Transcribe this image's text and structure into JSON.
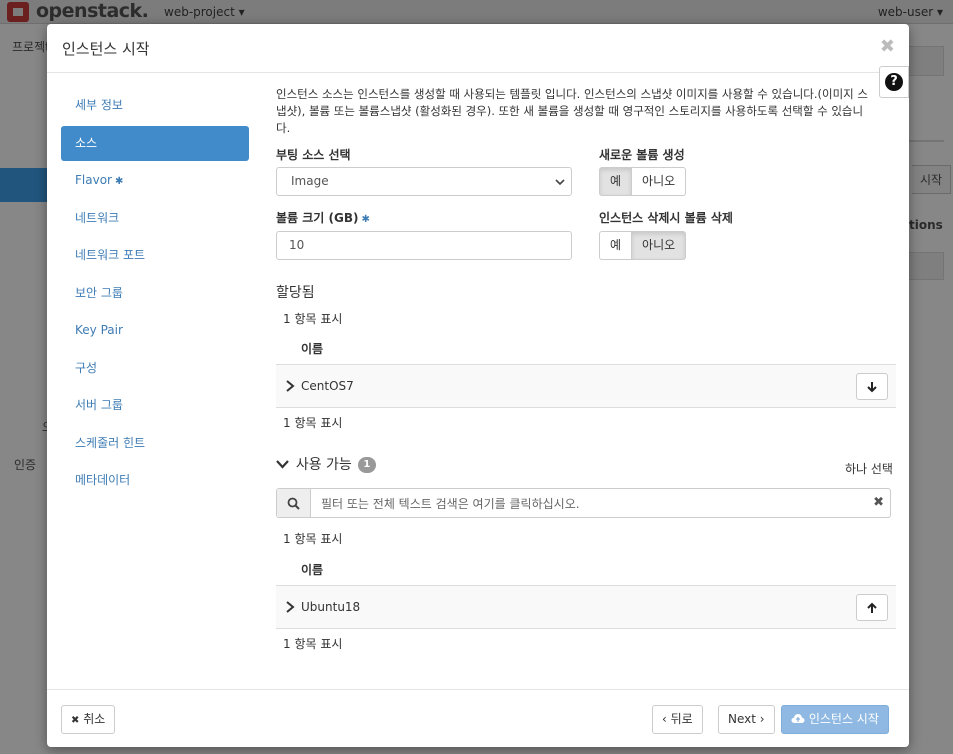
{
  "background": {
    "brand": "openstack.",
    "project": "web-project ▾",
    "user": "web-user ▾",
    "left_label_1": "프로젝t",
    "left_label_2": "인증",
    "left_label_3": "오",
    "right_btn": "시작",
    "right_label": "tions"
  },
  "modal": {
    "title": "인스턴스 시작",
    "close": "✖",
    "help": "?"
  },
  "sidebar": {
    "items": [
      {
        "label": "세부 정보"
      },
      {
        "label": "소스"
      },
      {
        "label": "Flavor"
      },
      {
        "label": "네트워크"
      },
      {
        "label": "네트워크 포트"
      },
      {
        "label": "보안 그룹"
      },
      {
        "label": "Key Pair"
      },
      {
        "label": "구성"
      },
      {
        "label": "서버 그룹"
      },
      {
        "label": "스케줄러 힌트"
      },
      {
        "label": "메타데이터"
      }
    ],
    "required_mark": "✱"
  },
  "source": {
    "description": "인스턴스 소스는 인스턴스를 생성할 때 사용되는 템플릿 입니다. 인스턴스의 스냅샷 이미지를 사용할 수 있습니다.(이미지 스냅샷), 볼륨 또는 볼륨스냅샷 (활성화된 경우). 또한 새 볼륨을 생성할 때 영구적인 스토리지를 사용하도록 선택할 수 있습니다.",
    "boot_source_label": "부팅 소스 선택",
    "boot_source_value": "Image",
    "new_volume_label": "새로운 볼륨 생성",
    "new_volume_yes": "예",
    "new_volume_no": "아니오",
    "volume_size_label": "볼륨 크기 (GB)",
    "volume_size_value": "10",
    "delete_volume_label": "인스턴스 삭제시 볼륨 삭제",
    "delete_volume_yes": "예",
    "delete_volume_no": "아니오"
  },
  "allocated": {
    "title": "할당됨",
    "count_top": "1 항목 표시",
    "col_name": "이름",
    "rows": [
      {
        "name": "CentOS7"
      }
    ],
    "count_bottom": "1 항목 표시"
  },
  "available": {
    "title": "사용 가능",
    "badge": "1",
    "select_one": "하나 선택",
    "search_placeholder": "필터 또는 전체 텍스트 검색은 여기를 클릭하십시오.",
    "count_top": "1 항목 표시",
    "col_name": "이름",
    "rows": [
      {
        "name": "Ubuntu18"
      }
    ],
    "count_bottom": "1 항목 표시"
  },
  "footer": {
    "cancel": "취소",
    "back": "‹ 뒤로",
    "next": "Next ›",
    "launch": "인스턴스 시작"
  }
}
